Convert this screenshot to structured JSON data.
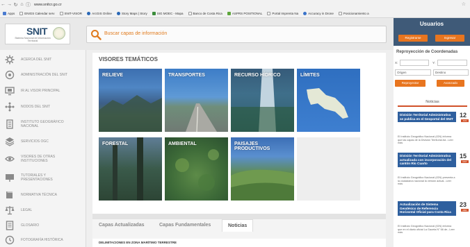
{
  "browser": {
    "url": "www.snitcr.go.cr",
    "bookmarks": [
      "Apps",
      "ENIGS Calendar serv",
      "SNIT-VISOR",
      "ArcGIS Online",
      "Story Maps | Story",
      "SIG MOEC - Mapa",
      "Banco de Costa Rica",
      "ASPRS POSITIONAL",
      "Portal Imprenta Na",
      "Accuracy in Drone",
      "Posicionamiento a"
    ]
  },
  "header": {
    "logo_text": "SNIT",
    "logo_subtitle": "Sistema Nacional de Información Territorial",
    "search_placeholder": "Buscar capas de información"
  },
  "sidebar": {
    "items": [
      {
        "label": "ACERCA DEL SNIT",
        "icon": "gear-icon"
      },
      {
        "label": "ADMINISTRACIÓN DEL SNIT",
        "icon": "globe-gear-icon"
      },
      {
        "label": "IR AL VISOR PRINCIPAL",
        "icon": "monitor-icon"
      },
      {
        "label": "NODOS DEL SNIT",
        "icon": "network-icon"
      },
      {
        "label": "INSTITUTO GEOGRÁFICO NACIONAL",
        "icon": "building-icon"
      },
      {
        "label": "SERVICIOS OGC",
        "icon": "layers-icon"
      },
      {
        "label": "VISORES DE OTRAS INSTITUCIONES",
        "icon": "eye-icon"
      },
      {
        "label": "TUTORIALES Y PRESENTACIONES",
        "icon": "presentation-icon"
      },
      {
        "label": "NORMATIVA TÉCNICA",
        "icon": "book-icon"
      },
      {
        "label": "LEGAL",
        "icon": "scales-icon"
      },
      {
        "label": "GLOSARIO",
        "icon": "document-icon"
      },
      {
        "label": "FOTOGRAFÍA HISTÓRICA",
        "icon": "history-icon"
      }
    ]
  },
  "main": {
    "section_title": "VISORES TEMÁTICOS",
    "tiles": [
      {
        "label": "RELIEVE"
      },
      {
        "label": "TRANSPORTES"
      },
      {
        "label": "RECURSO HÍDRICO"
      },
      {
        "label": "LÍMITES"
      },
      {
        "label": "FORESTAL"
      },
      {
        "label": "AMBIENTAL"
      },
      {
        "label": "PAISAJES PRODUCTIVOS"
      },
      {
        "label": ""
      }
    ],
    "tabs": [
      "Capas Actualizadas",
      "Capas Fundamentales",
      "Noticias"
    ],
    "news_line": "DELIMITACIONES EN ZONA MARÍTIMO TERRESTRE"
  },
  "right": {
    "usuarios_title": "Usuarios",
    "register_label": "Registrarse",
    "login_label": "Ingresar",
    "reproj_title": "Reproyección de Coordenadas",
    "x_label": "X:",
    "y_label": "Y:",
    "origin_value": "Origen",
    "dest_value": "Destino",
    "reproject_label": "Reproyectar",
    "advanced_label": "Avanzado",
    "news_title": "Noticias",
    "news": [
      {
        "title": "División Territorial Administrativa se publica en el Geoportal del SNIT",
        "desc": "El Instituto Geográfico Nacional (IGN) informa que las capas de la División Territorial Ad...Leer más",
        "day": "12",
        "month": "JUN"
      },
      {
        "title": "División Territorial Administrativa actualizada con incorporación del cantón Río Cuarto",
        "desc": "El Instituto Geográfico Nacional (IGN) presenta a la ciudadanía nacional la versión actual...Leer más",
        "day": "15",
        "month": "MAY"
      },
      {
        "title": "Actualización de Sistema Geodésico de Referencia Horizontal Oficial para Costa Rica",
        "desc": "El Instituto Geográfico Nacional (IGN) informa que en el diario oficial La Gaceta N° 66 de...Leer más",
        "day": "23",
        "month": "ABR"
      }
    ]
  },
  "colors": {
    "accent": "#e8751f",
    "header_blue": "#3f5a78",
    "news_blue": "#2e5f9e",
    "news_red": "#d05028"
  }
}
